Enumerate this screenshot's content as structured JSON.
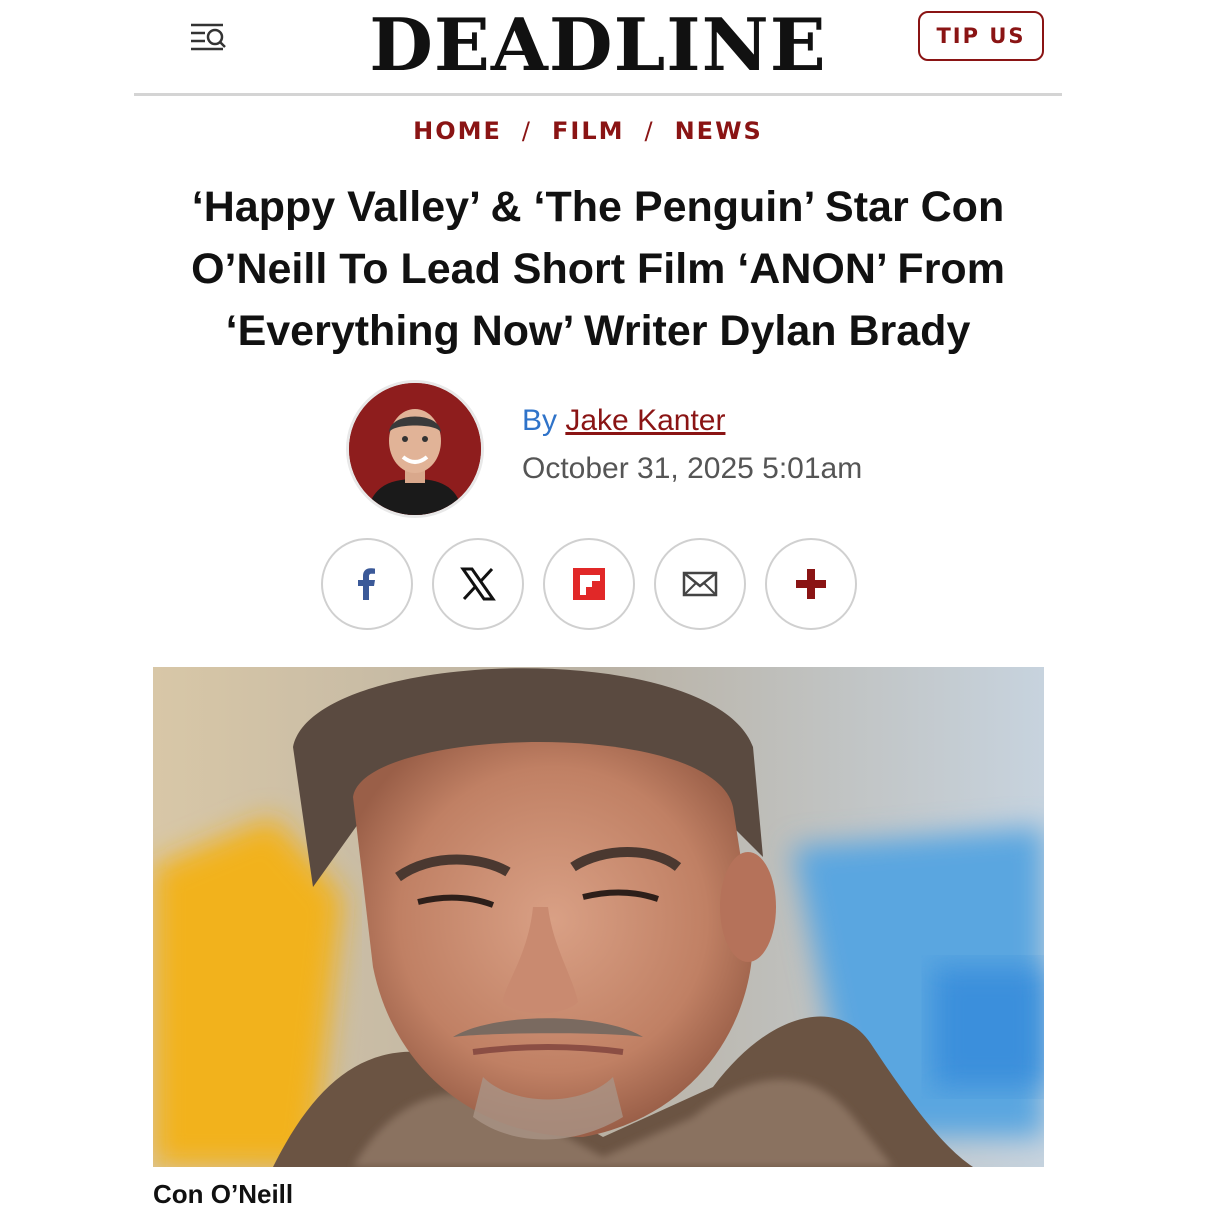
{
  "header": {
    "logo": "DEADLINE",
    "tip_label": "TIP US",
    "menu_icon": "menu-search-icon"
  },
  "breadcrumb": [
    "HOME",
    "FILM",
    "NEWS"
  ],
  "article": {
    "headline_lines": [
      "‘Happy Valley’ & ‘The Penguin’ Star Con",
      "O’Neill To Lead Short Film ‘ANON’ From",
      "‘Everything Now’ Writer Dylan Brady"
    ],
    "by_prefix": "By",
    "author": "Jake Kanter",
    "date": "October 31, 2025 5:01am",
    "caption": "Con O’Neill"
  },
  "share": [
    {
      "icon": "facebook-icon",
      "color": "#3b5998"
    },
    {
      "icon": "x-icon",
      "color": "#111111"
    },
    {
      "icon": "flipboard-icon",
      "color": "#e12828"
    },
    {
      "icon": "email-icon",
      "color": "#444444"
    },
    {
      "icon": "plus-icon",
      "color": "#8a1414"
    }
  ],
  "colors": {
    "brand": "#8a1414",
    "by_link": "#2f73c9"
  }
}
